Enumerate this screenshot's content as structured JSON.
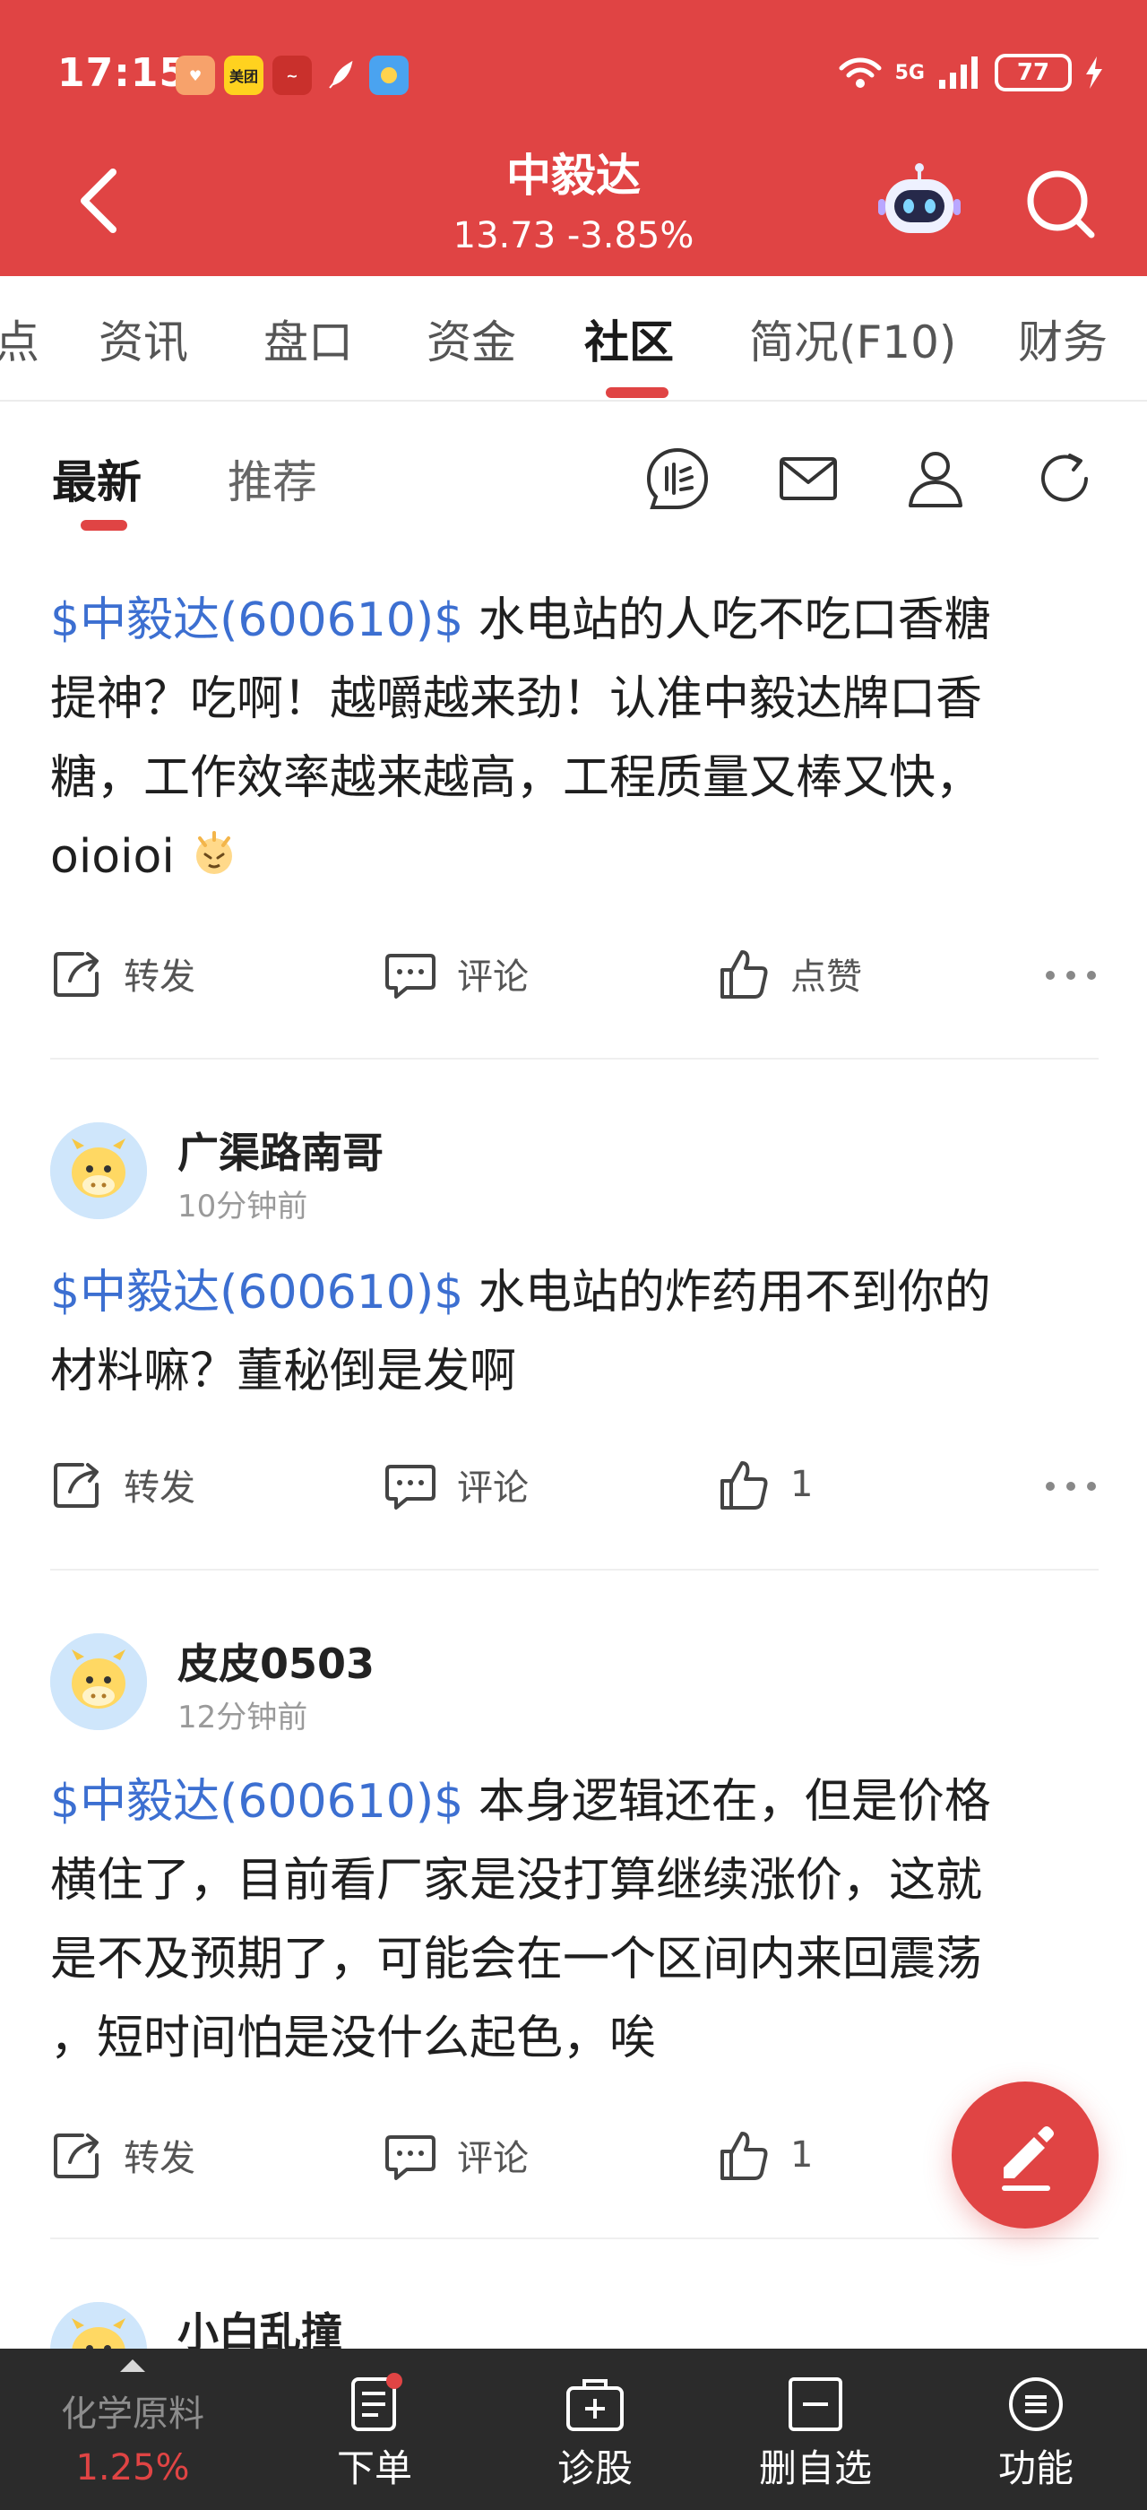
{
  "status_bar": {
    "time": "17:15",
    "notifications": [
      "美团"
    ],
    "network": "5G",
    "battery": "77"
  },
  "header": {
    "stock_name": "中毅达",
    "stock_quote": "13.73 -3.85%",
    "accent_color": "#e04444"
  },
  "tabs": [
    {
      "label": "点"
    },
    {
      "label": "资讯"
    },
    {
      "label": "盘口"
    },
    {
      "label": "资金"
    },
    {
      "label": "社区",
      "active": true
    },
    {
      "label": "简况(F10)"
    },
    {
      "label": "财务"
    }
  ],
  "subtabs": [
    {
      "label": "最新",
      "active": true
    },
    {
      "label": "推荐"
    }
  ],
  "subtab_icons": [
    "community-logo-icon",
    "mail-icon",
    "user-icon",
    "refresh-icon"
  ],
  "posts": [
    {
      "mention": "$中毅达(600610)$",
      "lines": [
        " 水电站的人吃不吃口香糖",
        "提神？吃啊！越嚼越来劲！认准中毅达牌口香",
        "糖，工作效率越来越高，工程质量又棒又快，",
        "oioioi"
      ],
      "repost": "转发",
      "comment": "评论",
      "like": "点赞"
    },
    {
      "author": "广渠路南哥",
      "time": "10分钟前",
      "mention": "$中毅达(600610)$",
      "lines": [
        " 水电站的炸药用不到你的",
        "材料嘛？董秘倒是发啊"
      ],
      "repost": "转发",
      "comment": "评论",
      "like": "1"
    },
    {
      "author": "皮皮0503",
      "time": "12分钟前",
      "mention": "$中毅达(600610)$",
      "lines": [
        " 本身逻辑还在，但是价格",
        "横住了，目前看厂家是没打算继续涨价，这就",
        "是不及预期了，可能会在一个区间内来回震荡",
        "，短时间怕是没什么起色，唉"
      ],
      "repost": "转发",
      "comment": "评论",
      "like": "1"
    },
    {
      "author": "小白乱撞"
    }
  ],
  "bottom_bar": {
    "sector_name": "化学原料",
    "sector_change": "1.25%",
    "items": [
      {
        "label": "下单",
        "icon": "order-icon"
      },
      {
        "label": "诊股",
        "icon": "diagnose-icon"
      },
      {
        "label": "删自选",
        "icon": "remove-watchlist-icon"
      },
      {
        "label": "功能",
        "icon": "menu-icon"
      }
    ]
  }
}
